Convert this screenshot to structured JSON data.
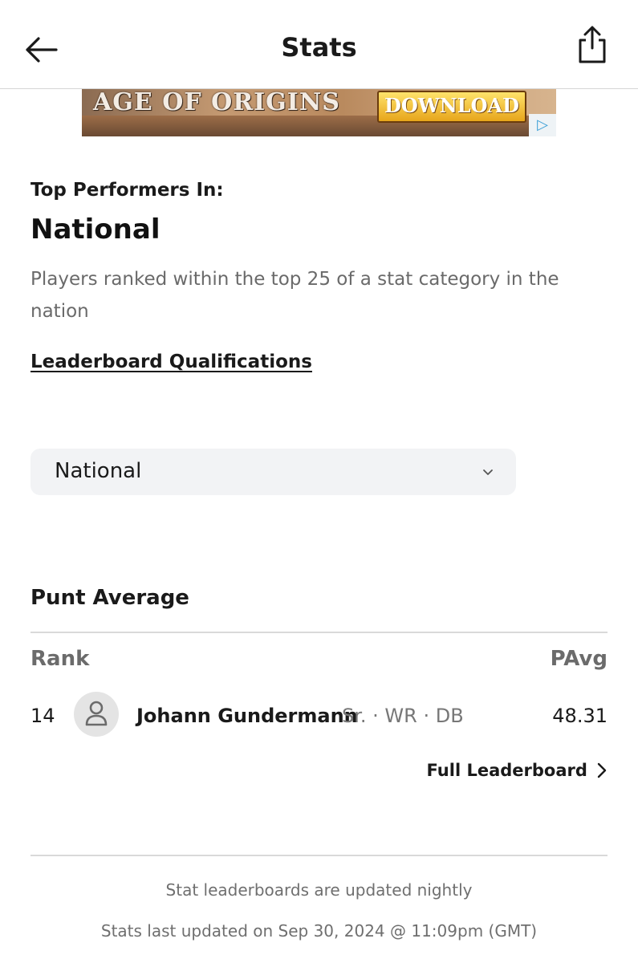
{
  "header": {
    "title": "Stats",
    "back_icon": "arrow-left-icon",
    "share_icon": "share-icon"
  },
  "ad": {
    "headline": "AGE OF ORIGINS",
    "cta": "DOWNLOAD",
    "badge_icon": "adchoices-icon"
  },
  "intro": {
    "eyebrow": "Top Performers In:",
    "scope": "National",
    "description": "Players ranked within the top 25 of a stat category in the nation",
    "qualifications_link": "Leaderboard Qualifications"
  },
  "filter": {
    "selected": "National",
    "chevron_icon": "chevron-down-icon"
  },
  "leaderboard": {
    "title": "Punt Average",
    "columns": {
      "rank": "Rank",
      "value": "PAvg"
    },
    "rows": [
      {
        "rank": "14",
        "name": "Johann Gundermann",
        "meta": "Sr. · WR · DB",
        "value": "48.31",
        "avatar_icon": "person-icon"
      }
    ],
    "full_link": "Full Leaderboard"
  },
  "footer": {
    "note": "Stat leaderboards are updated nightly",
    "last_updated": "Stats last updated on Sep 30, 2024 @ 11:09pm (GMT)"
  },
  "colors": {
    "text": "#1a1a1a",
    "muted": "#6f6f6f",
    "select_bg": "#f2f3f5",
    "avatar_bg": "#e4e4e4"
  }
}
